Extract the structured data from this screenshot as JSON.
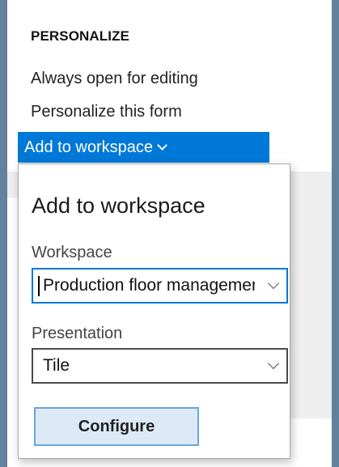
{
  "personalize": {
    "title": "PERSONALIZE",
    "items": [
      {
        "label": "Always open for editing"
      },
      {
        "label": "Personalize this form"
      },
      {
        "label": "Add to workspace",
        "selected": true
      }
    ]
  },
  "flyout": {
    "title": "Add to workspace",
    "workspace": {
      "label": "Workspace",
      "value": "Production floor management"
    },
    "presentation": {
      "label": "Presentation",
      "value": "Tile"
    },
    "configure_label": "Configure"
  },
  "colors": {
    "accent": "#0078d7",
    "button_bg": "#dce9f6",
    "button_border": "#6aa6dc",
    "background": "#62819c"
  }
}
